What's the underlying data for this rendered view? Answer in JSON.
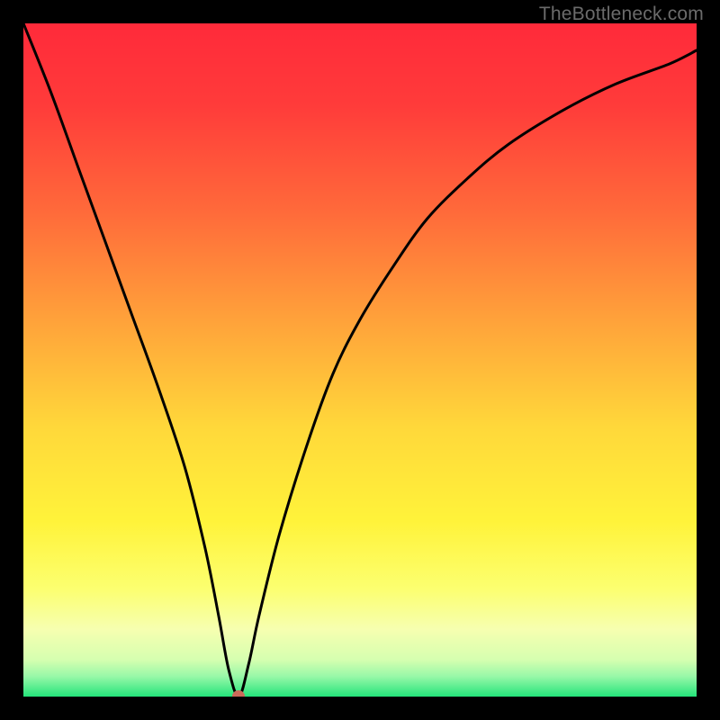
{
  "watermark": {
    "text": "TheBottleneck.com"
  },
  "colors": {
    "frame": "#000000",
    "gradient_stops": [
      {
        "offset": 0.0,
        "color": "#ff2a3a"
      },
      {
        "offset": 0.12,
        "color": "#ff3b3a"
      },
      {
        "offset": 0.28,
        "color": "#ff6a3a"
      },
      {
        "offset": 0.45,
        "color": "#ffa53a"
      },
      {
        "offset": 0.6,
        "color": "#ffd83a"
      },
      {
        "offset": 0.74,
        "color": "#fff33a"
      },
      {
        "offset": 0.84,
        "color": "#fcff70"
      },
      {
        "offset": 0.9,
        "color": "#f6ffb0"
      },
      {
        "offset": 0.945,
        "color": "#d6ffb0"
      },
      {
        "offset": 0.97,
        "color": "#98f8a8"
      },
      {
        "offset": 1.0,
        "color": "#24e47a"
      }
    ],
    "curve_stroke": "#000000",
    "marker_fill": "#cc6a5a"
  },
  "chart_data": {
    "type": "line",
    "title": "",
    "xlabel": "",
    "ylabel": "",
    "xlim": [
      0,
      100
    ],
    "ylim": [
      0,
      100
    ],
    "grid": false,
    "legend": false,
    "series": [
      {
        "name": "bottleneck-curve",
        "x": [
          0,
          4,
          8,
          12,
          16,
          20,
          24,
          27,
          29,
          30.5,
          32,
          33.5,
          35,
          38,
          42,
          46,
          50,
          55,
          60,
          66,
          72,
          80,
          88,
          96,
          100
        ],
        "y": [
          100,
          90,
          79,
          68,
          57,
          46,
          34,
          22,
          12,
          4,
          0,
          5,
          12,
          24,
          37,
          48,
          56,
          64,
          71,
          77,
          82,
          87,
          91,
          94,
          96
        ]
      }
    ],
    "annotations": [
      {
        "type": "marker",
        "x": 32,
        "y": 0,
        "label": "optimal-point"
      }
    ]
  }
}
